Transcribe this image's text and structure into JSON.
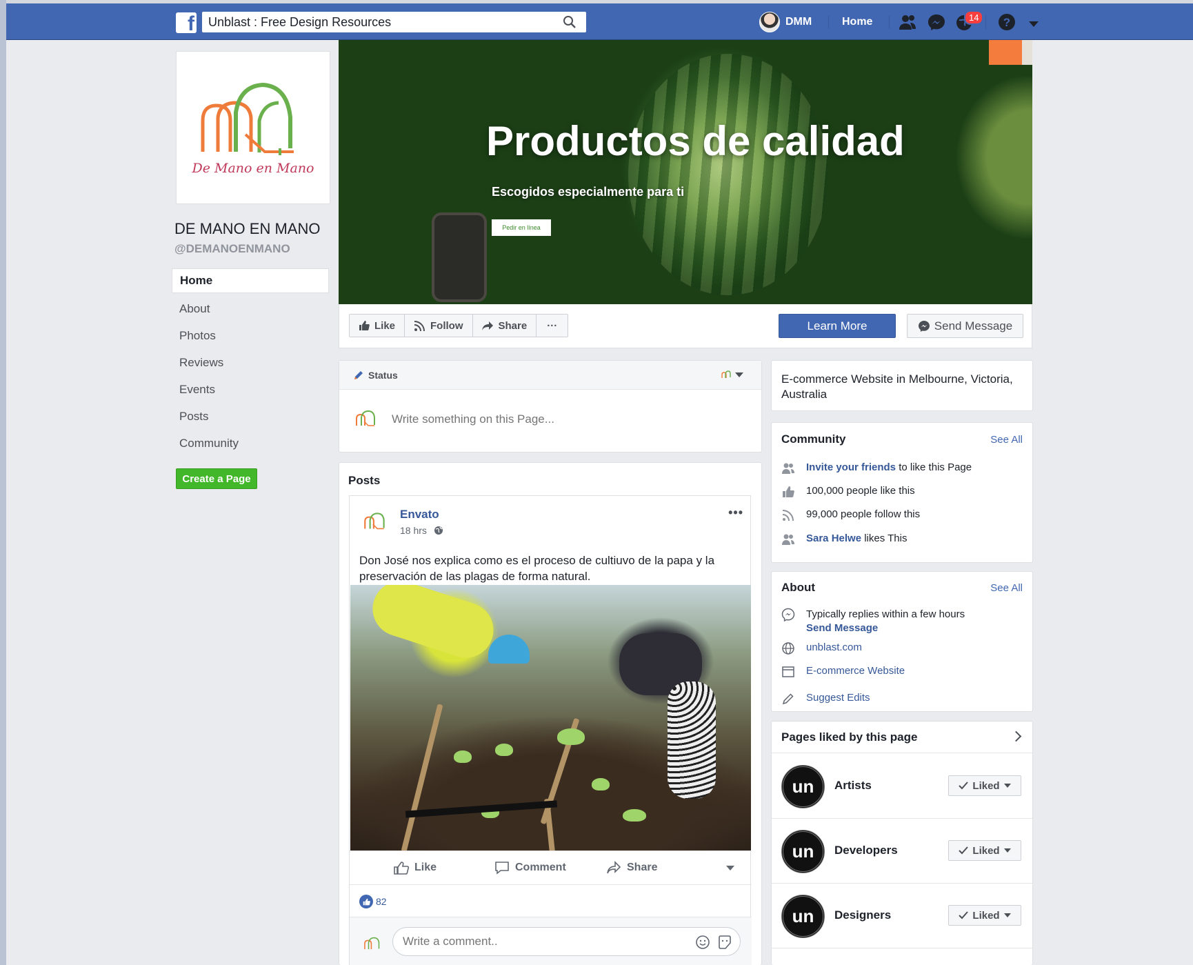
{
  "topbar": {
    "search_value": "Unblast : Free Design Resources",
    "user_name": "DMM",
    "home_label": "Home",
    "notification_count": "14",
    "brand_color": "#4267b2"
  },
  "page": {
    "logo_text": "De Mano en Mano",
    "name": "DE MANO EN MANO",
    "handle": "@DEMANOENMANO",
    "nav": [
      "Home",
      "About",
      "Photos",
      "Reviews",
      "Events",
      "Posts",
      "Community"
    ],
    "create_page_label": "Create a Page"
  },
  "cover": {
    "title": "Productos de calidad",
    "subtitle": "Escogidos especialmente para ti",
    "button_label": "Pedir en línea"
  },
  "actions": {
    "like": "Like",
    "follow": "Follow",
    "share": "Share",
    "more": "···",
    "learn_more": "Learn More",
    "send_message": "Send Message"
  },
  "composer": {
    "tab_label": "Status",
    "placeholder": "Write something on this Page..."
  },
  "posts": {
    "section_title": "Posts",
    "item": {
      "author": "Envato",
      "time": "18 hrs",
      "text": "Don José nos explica como es el proceso de cultiuvo de  la papa y la preservación de las plagas de forma natural.",
      "like_label": "Like",
      "comment_label": "Comment",
      "share_label": "Share",
      "reaction_count": "82",
      "comment_placeholder": "Write a comment.."
    }
  },
  "sidebar": {
    "category": "E-commerce Website in Melbourne, Victoria, Australia",
    "community": {
      "title": "Community",
      "see_all": "See All",
      "invite_link": "Invite your friends",
      "invite_rest": "to like this Page",
      "likes": "100,000 people like this",
      "follows": "99,000 people follow this",
      "friend_name": "Sara Helwe",
      "friend_rest": "likes This"
    },
    "about": {
      "title": "About",
      "see_all": "See All",
      "reply_time": "Typically replies within a few hours",
      "send_message": "Send Message",
      "website": "unblast.com",
      "category": "E-commerce Website",
      "suggest": "Suggest Edits"
    },
    "pages_liked": {
      "title": "Pages liked by this page",
      "items": [
        {
          "name": "Artists",
          "button": "Liked",
          "avatar": "un"
        },
        {
          "name": "Developers",
          "button": "Liked",
          "avatar": "un"
        },
        {
          "name": "Designers",
          "button": "Liked",
          "avatar": "un"
        }
      ]
    }
  }
}
